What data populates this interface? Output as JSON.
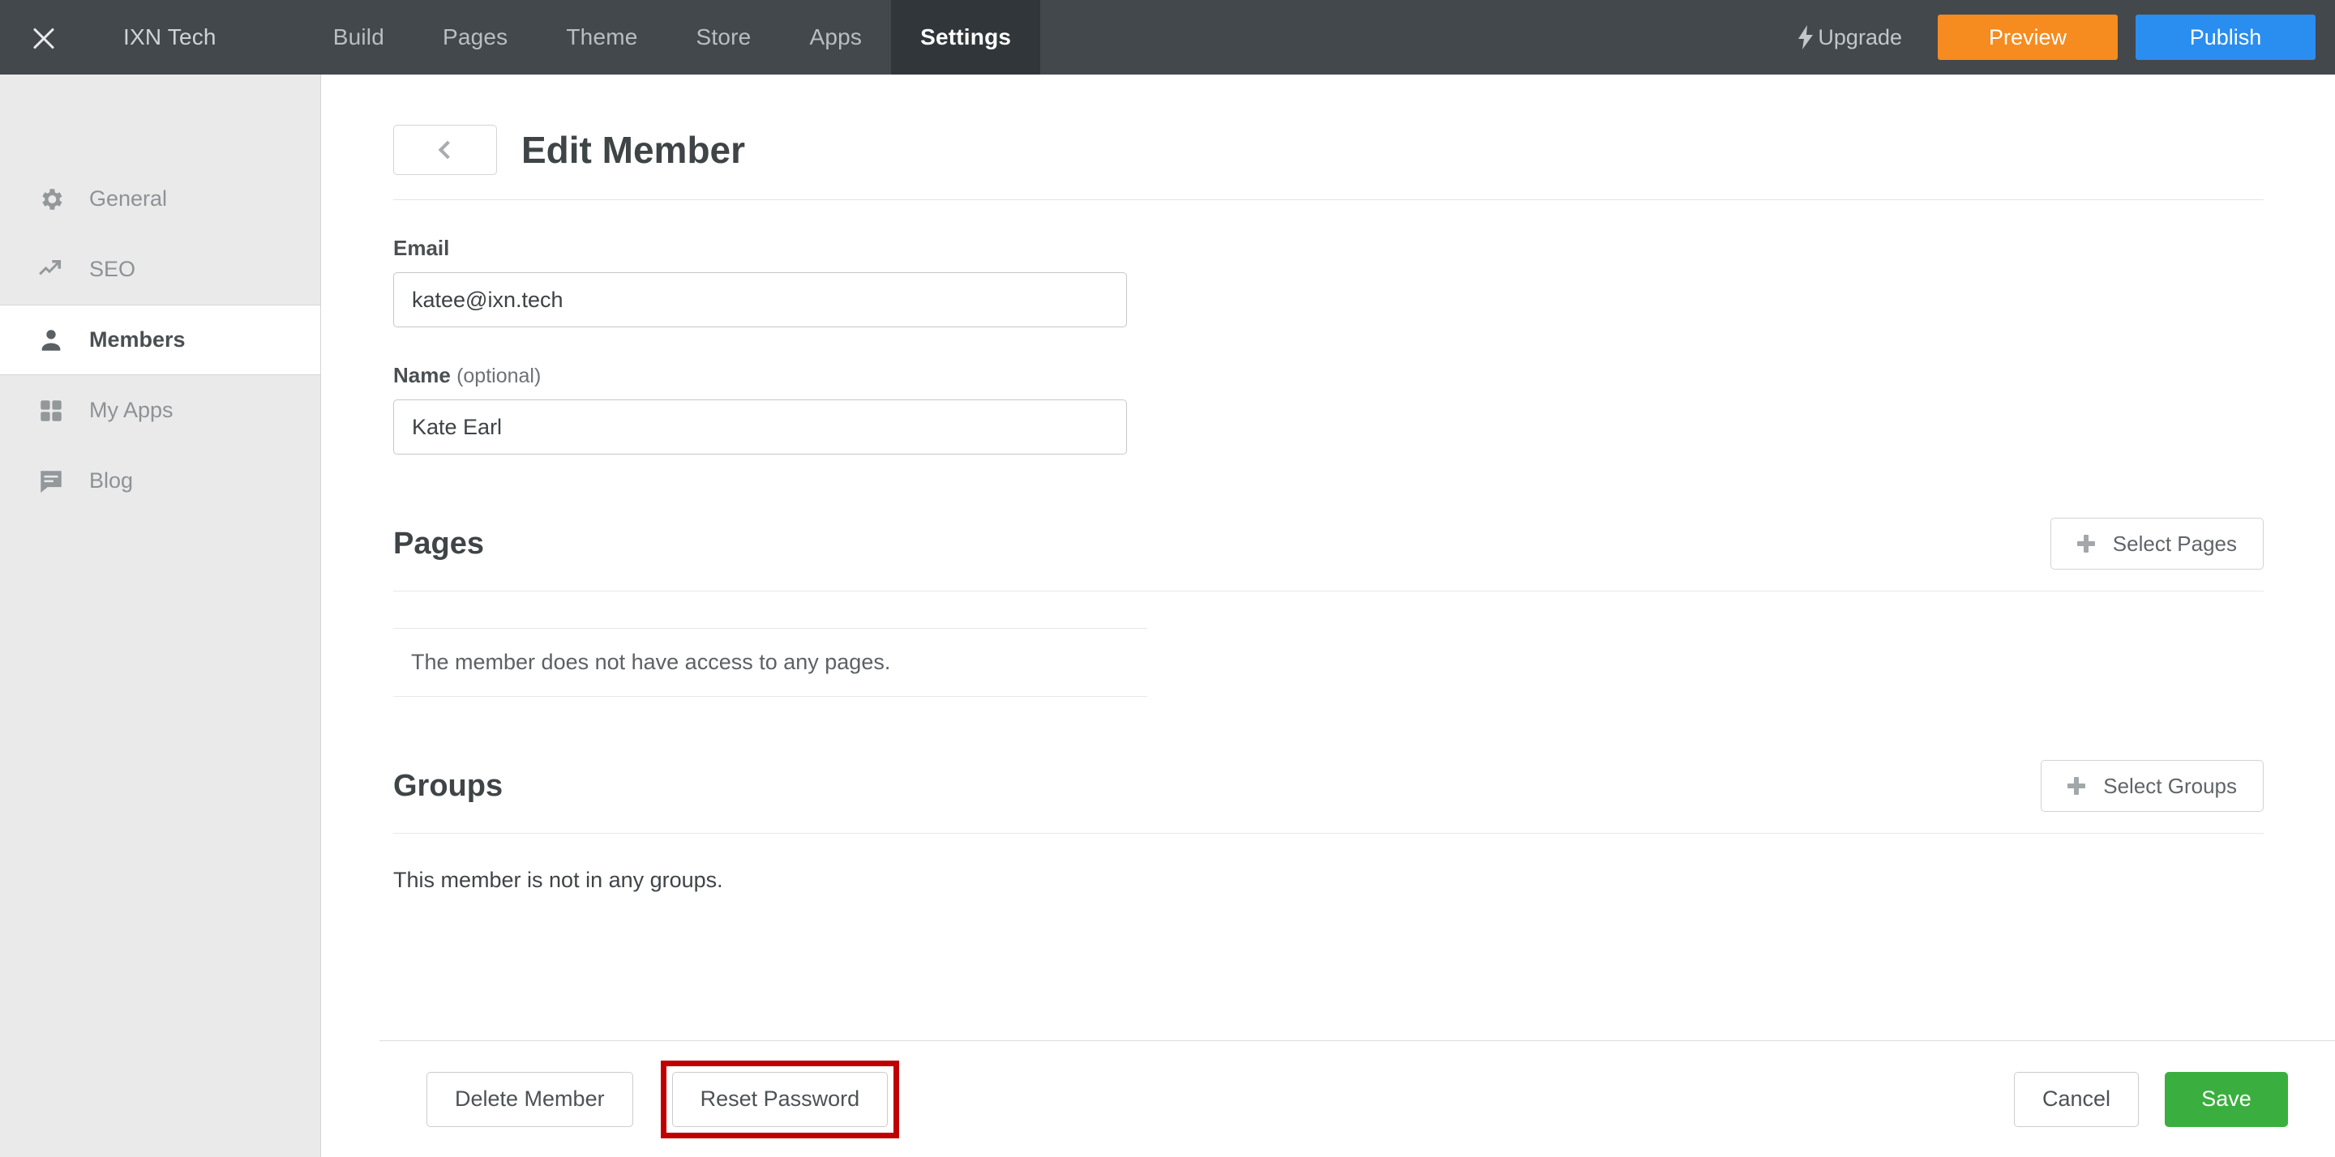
{
  "topbar": {
    "close_icon": "close-icon",
    "site_name": "IXN Tech",
    "tabs": [
      {
        "label": "Build",
        "active": false
      },
      {
        "label": "Pages",
        "active": false
      },
      {
        "label": "Theme",
        "active": false
      },
      {
        "label": "Store",
        "active": false
      },
      {
        "label": "Apps",
        "active": false
      },
      {
        "label": "Settings",
        "active": true
      }
    ],
    "upgrade_label": "Upgrade",
    "upgrade_icon": "lightning-bolt-icon",
    "preview_label": "Preview",
    "publish_label": "Publish",
    "colors": {
      "bar_bg": "#43484c",
      "active_tab_bg": "#31363a",
      "preview_bg": "#f68b1f",
      "publish_bg": "#2a8df0"
    }
  },
  "sidebar": {
    "items": [
      {
        "label": "General",
        "icon": "gear-icon",
        "active": false
      },
      {
        "label": "SEO",
        "icon": "trending-up-icon",
        "active": false
      },
      {
        "label": "Members",
        "icon": "person-icon",
        "active": true
      },
      {
        "label": "My Apps",
        "icon": "grid-icon",
        "active": false
      },
      {
        "label": "Blog",
        "icon": "comment-icon",
        "active": false
      }
    ]
  },
  "page": {
    "back_icon": "chevron-left-icon",
    "title": "Edit Member"
  },
  "form": {
    "email": {
      "label": "Email",
      "value": "katee@ixn.tech",
      "placeholder": "Email"
    },
    "name": {
      "label": "Name",
      "optional_note": "(optional)",
      "value": "Kate Earl",
      "placeholder": "Name"
    }
  },
  "pages_section": {
    "title": "Pages",
    "select_button": "Select Pages",
    "select_icon": "plus-icon",
    "empty_text": "The member does not have access to any pages."
  },
  "groups_section": {
    "title": "Groups",
    "select_button": "Select Groups",
    "select_icon": "plus-icon",
    "empty_text": "This member is not in any groups."
  },
  "footer": {
    "delete_label": "Delete Member",
    "reset_label": "Reset Password",
    "cancel_label": "Cancel",
    "save_label": "Save",
    "highlight_color": "#c00000",
    "save_color": "#3aaf3f"
  }
}
